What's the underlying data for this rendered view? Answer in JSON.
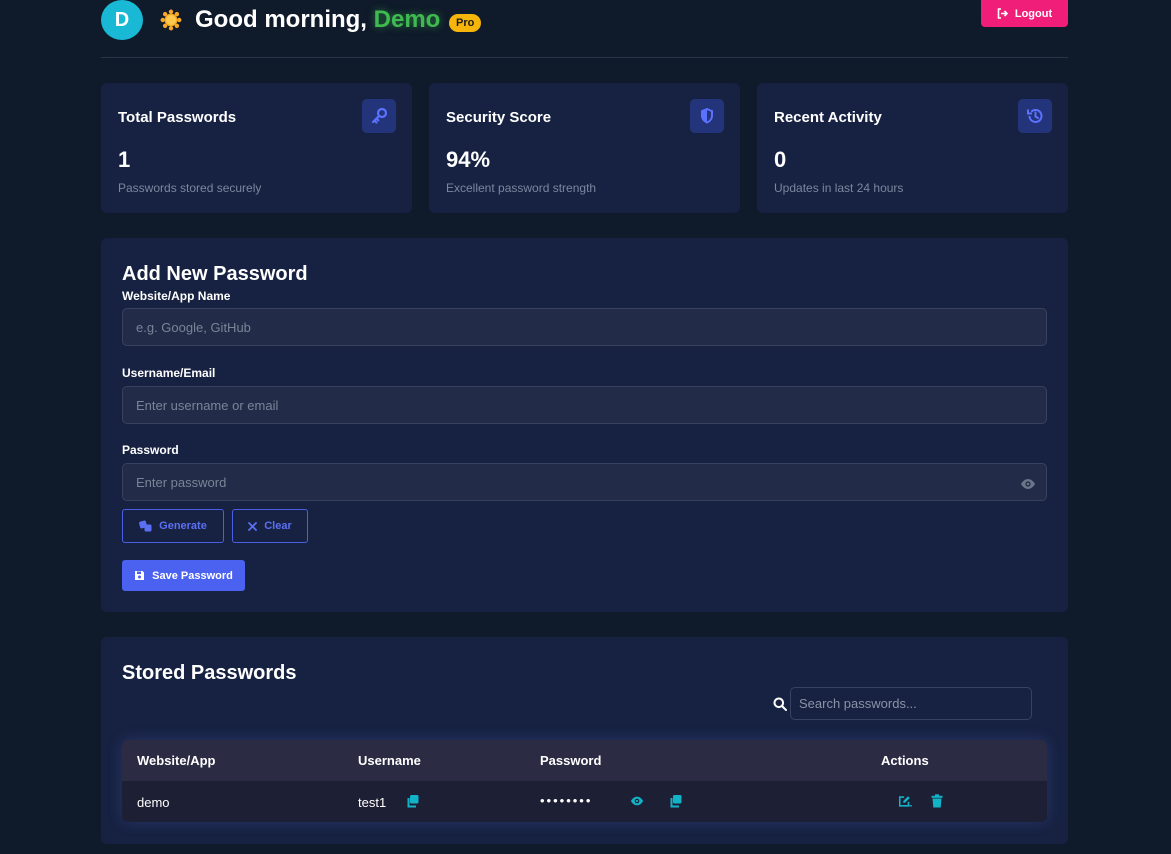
{
  "header": {
    "avatar_initial": "D",
    "greeting_prefix": "Good morning, ",
    "user_name": "Demo",
    "badge": "Pro",
    "logout_label": "Logout"
  },
  "stats": [
    {
      "title": "Total Passwords",
      "value": "1",
      "desc": "Passwords stored securely",
      "icon": "key-icon"
    },
    {
      "title": "Security Score",
      "value": "94%",
      "desc": "Excellent password strength",
      "icon": "shield-icon"
    },
    {
      "title": "Recent Activity",
      "value": "0",
      "desc": "Updates in last 24 hours",
      "icon": "history-icon"
    }
  ],
  "form": {
    "title": "Add New Password",
    "website_label": "Website/App Name",
    "website_placeholder": "e.g. Google, GitHub",
    "username_label": "Username/Email",
    "username_placeholder": "Enter username or email",
    "password_label": "Password",
    "password_placeholder": "Enter password",
    "generate_label": "Generate",
    "clear_label": "Clear",
    "save_label": "Save Password"
  },
  "stored": {
    "title": "Stored Passwords",
    "search_placeholder": "Search passwords...",
    "columns": [
      "Website/App",
      "Username",
      "Password",
      "Actions"
    ],
    "rows": [
      {
        "website": "demo",
        "username": "test1",
        "password_mask": "••••••••"
      }
    ]
  },
  "colors": {
    "background": "#0f1a2a",
    "card": "#172242",
    "accent": "#4b61f0",
    "logout": "#f01e78",
    "teal": "#19b8d4",
    "username_green": "#3fb950",
    "badge": "#f5b50a"
  }
}
